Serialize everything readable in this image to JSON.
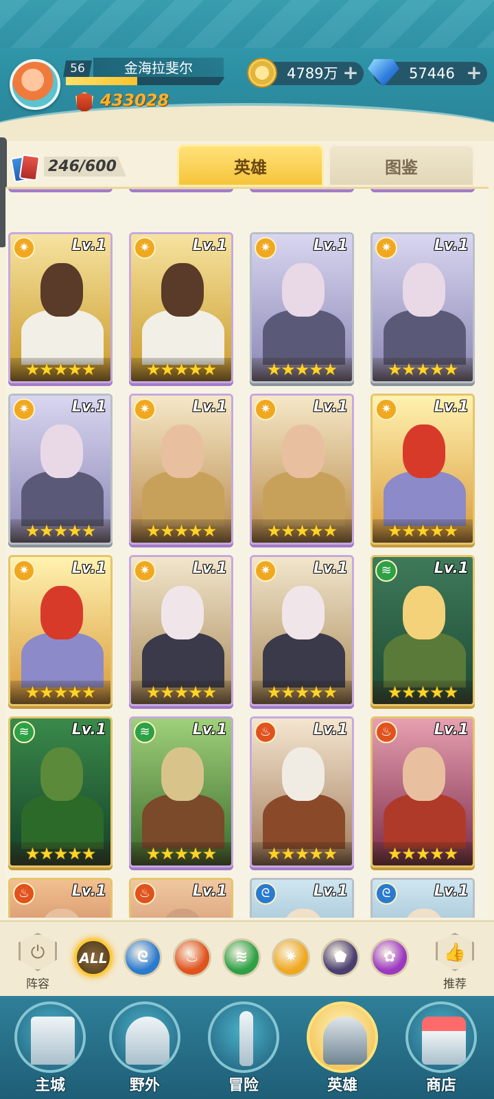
{
  "header": {
    "level": "56",
    "player_name": "金海拉斐尔",
    "xp_progress": 0.45,
    "power": "433028",
    "gold": "4789万",
    "gems": "57446"
  },
  "tabs": {
    "hero_count": "246/600",
    "heroes_label": "英雄",
    "codex_label": "图鉴"
  },
  "heroes": [
    {
      "lv": "Lv.1",
      "elem": "light"
    },
    {
      "lv": "Lv.1",
      "elem": "light"
    },
    {
      "lv": "Lv.1",
      "elem": "light"
    },
    {
      "lv": "Lv.1",
      "elem": "light"
    },
    {
      "lv": "Lv.1",
      "elem": "light"
    },
    {
      "lv": "Lv.1",
      "elem": "light"
    },
    {
      "lv": "Lv.1",
      "elem": "light"
    },
    {
      "lv": "Lv.1",
      "elem": "light"
    },
    {
      "lv": "Lv.1",
      "elem": "light"
    },
    {
      "lv": "Lv.1",
      "elem": "light"
    },
    {
      "lv": "Lv.1",
      "elem": "light"
    },
    {
      "lv": "Lv.1",
      "elem": "nature"
    },
    {
      "lv": "Lv.1",
      "elem": "nature"
    },
    {
      "lv": "Lv.1",
      "elem": "nature"
    },
    {
      "lv": "Lv.1",
      "elem": "fire"
    },
    {
      "lv": "Lv.1",
      "elem": "fire"
    },
    {
      "lv": "Lv.1",
      "elem": "fire"
    },
    {
      "lv": "Lv.1",
      "elem": "fire"
    },
    {
      "lv": "Lv.1",
      "elem": "water"
    },
    {
      "lv": "Lv.1",
      "elem": "water"
    }
  ],
  "filter": {
    "lineup_label": "阵容",
    "recommend_label": "推荐",
    "all_label": "ALL",
    "elements": [
      "water",
      "fire",
      "nature",
      "light",
      "dark",
      "arcane"
    ]
  },
  "nav": {
    "main_city": "主城",
    "wild": "野外",
    "adventure": "冒险",
    "heroes": "英雄",
    "shop": "商店"
  },
  "colors": {
    "water": "#2a7ad0",
    "fire": "#e0521e",
    "nature": "#2ea045",
    "light": "#f0a820",
    "dark": "#4a3e70",
    "arcane": "#9c38c0"
  }
}
